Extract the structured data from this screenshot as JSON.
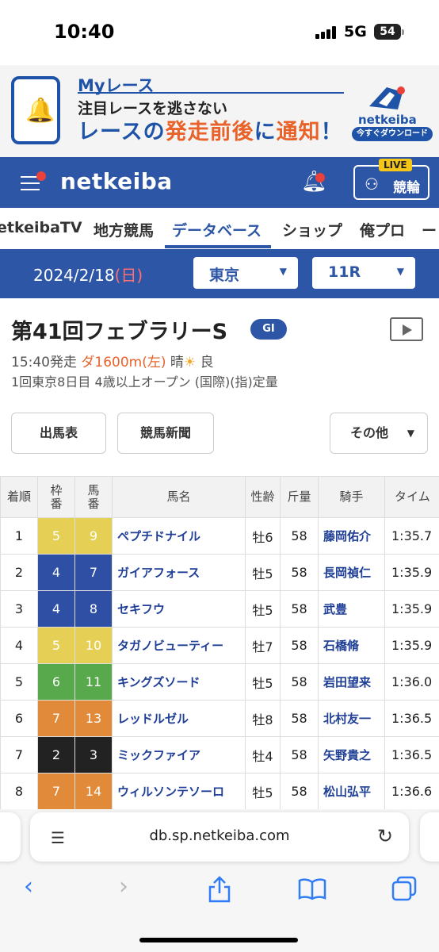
{
  "status": {
    "time": "10:40",
    "network": "5G",
    "battery": "54"
  },
  "ad": {
    "title": "Myレース",
    "sub": "注目レースを逃さない",
    "main_a": "レースの",
    "main_b": "発走前後",
    "main_c": "に",
    "main_d": "通知",
    "main_e": "！",
    "brand": "netkeiba",
    "cta": "今すぐダウンロード"
  },
  "header": {
    "logo": "netkeiba",
    "live": "LIVE",
    "keirin": "競輪"
  },
  "nav": {
    "tabs": [
      "etkeibaTV",
      "地方競馬",
      "データベース",
      "ショップ",
      "俺プロ",
      "ー"
    ]
  },
  "date_bar": {
    "date": "2024/2/18",
    "weekday": "(日)",
    "venue": "東京",
    "race_no": "11R"
  },
  "race": {
    "title": "第41回フェブラリーS",
    "grade": "GI",
    "start": "15:40発走",
    "surface": "ダ1600m(左)",
    "weather": "晴",
    "weather_icon": "☀",
    "track": "良",
    "conditions": "1回東京8日目  4歳以上オープン  (国際)(指)定量"
  },
  "buttons": {
    "entries": "出馬表",
    "newspaper": "競馬新聞",
    "other": "その他"
  },
  "table": {
    "headers": [
      "着順",
      "枠番",
      "馬番",
      "馬名",
      "性齢",
      "斤量",
      "騎手",
      "タイム"
    ],
    "rows": [
      {
        "pos": "1",
        "frame": "5",
        "num": "9",
        "horse": "ペプチドナイル",
        "sexage": "牡6",
        "weight": "58",
        "jockey": "藤岡佑介",
        "time": "1:35.7"
      },
      {
        "pos": "2",
        "frame": "4",
        "num": "7",
        "horse": "ガイアフォース",
        "sexage": "牡5",
        "weight": "58",
        "jockey": "長岡禎仁",
        "time": "1:35.9"
      },
      {
        "pos": "3",
        "frame": "4",
        "num": "8",
        "horse": "セキフウ",
        "sexage": "牡5",
        "weight": "58",
        "jockey": "武豊",
        "time": "1:35.9"
      },
      {
        "pos": "4",
        "frame": "5",
        "num": "10",
        "horse": "タガノビューティー",
        "sexage": "牡7",
        "weight": "58",
        "jockey": "石橋脩",
        "time": "1:35.9"
      },
      {
        "pos": "5",
        "frame": "6",
        "num": "11",
        "horse": "キングズソード",
        "sexage": "牡5",
        "weight": "58",
        "jockey": "岩田望来",
        "time": "1:36.0"
      },
      {
        "pos": "6",
        "frame": "7",
        "num": "13",
        "horse": "レッドルゼル",
        "sexage": "牡8",
        "weight": "58",
        "jockey": "北村友一",
        "time": "1:36.5"
      },
      {
        "pos": "7",
        "frame": "2",
        "num": "3",
        "horse": "ミックファイア",
        "sexage": "牡4",
        "weight": "58",
        "jockey": "矢野貴之",
        "time": "1:36.5"
      },
      {
        "pos": "8",
        "frame": "7",
        "num": "14",
        "horse": "ウィルソンテソーロ",
        "sexage": "牡5",
        "weight": "58",
        "jockey": "松山弘平",
        "time": "1:36.6"
      }
    ]
  },
  "frame_colors": {
    "2": "#222222",
    "4": "#2e4fa3",
    "5": "#e6cf55",
    "6": "#58a94c",
    "7": "#e08a3a"
  },
  "browser": {
    "url": "db.sp.netkeiba.com"
  },
  "icons": {
    "reader": "reader-icon",
    "reload": "reload-icon",
    "back": "back-icon",
    "forward": "forward-icon",
    "share": "share-icon",
    "bookmarks": "bookmarks-icon",
    "tabs": "tabs-icon"
  }
}
